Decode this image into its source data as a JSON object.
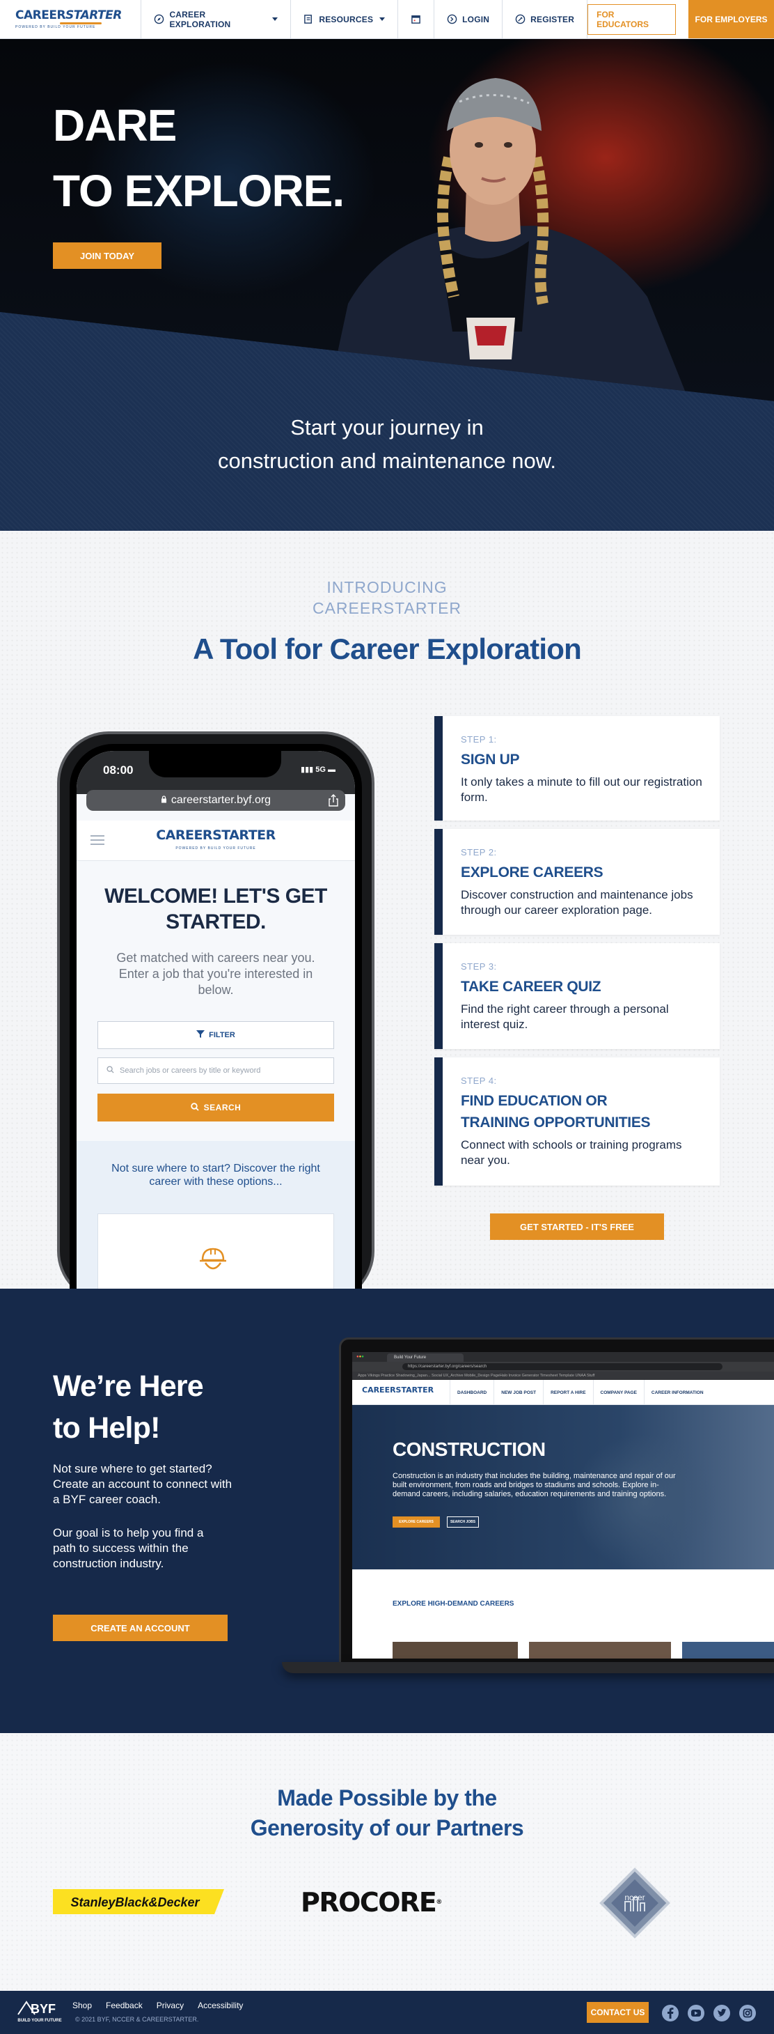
{
  "header": {
    "logo_text_a": "CAREER",
    "logo_text_b": "STARTER",
    "logo_sub": "POWERED BY BUILD YOUR FUTURE",
    "nav": {
      "career_exploration": "CAREER EXPLORATION",
      "resources": "RESOURCES",
      "login": "LOGIN",
      "register": "REGISTER",
      "for_educators": "FOR EDUCATORS",
      "for_employers": "FOR EMPLOYERS"
    }
  },
  "hero": {
    "title_line1": "DARE",
    "title_line2": "TO EXPLORE.",
    "cta": "JOIN TODAY",
    "tagline_line1": "Start your journey in",
    "tagline_line2": "construction and maintenance now."
  },
  "intro": {
    "eyebrow_line1": "INTRODUCING",
    "eyebrow_line2": "CAREERSTARTER",
    "title": "A Tool for Career Exploration",
    "phone": {
      "time": "08:00",
      "signal": "5G",
      "url": "careerstarter.byf.org",
      "welcome_line1": "WELCOME! LET'S GET",
      "welcome_line2": "STARTED.",
      "subtitle": "Get matched with careers near you. Enter a job that you're interested in below.",
      "filter_label": "FILTER",
      "search_placeholder": "Search jobs or careers by title or keyword",
      "search_label": "SEARCH",
      "not_sure": "Not sure where to start? Discover the right career with these options..."
    },
    "steps": [
      {
        "label": "STEP 1:",
        "title": "SIGN UP",
        "desc": "It only takes a minute to fill out our registration form."
      },
      {
        "label": "STEP 2:",
        "title": "EXPLORE CAREERS",
        "desc": "Discover construction and maintenance jobs through our career exploration page."
      },
      {
        "label": "STEP 3:",
        "title": "TAKE CAREER QUIZ",
        "desc": "Find the right career through a personal interest quiz."
      },
      {
        "label": "STEP 4:",
        "title_line1": "FIND EDUCATION OR",
        "title_line2": "TRAINING OPPORTUNITIES",
        "desc": "Connect with schools or training programs near you."
      }
    ],
    "cta": "GET STARTED - IT'S FREE"
  },
  "help": {
    "title_line1": "We’re Here",
    "title_line2": "to Help!",
    "p1": "Not sure where to get started? Create an account to connect with a BYF career coach.",
    "p2": "Our goal is to help you find a path to success within the construction industry.",
    "cta": "CREATE AN ACCOUNT",
    "laptop": {
      "tab_title": "Build Your Future",
      "url": "https://careerstarter.byf.org/careers/search",
      "bookmarks": "Apps   Vikings Practice   Shadowing_Japan...   Social   UX_Archive   Mobile_Design   PageHalo   Invoice Generator   Timesheet Template   UNAA Stuff",
      "logo": "CAREERSTARTER",
      "nav": [
        "DASHBOARD",
        "NEW JOB POST",
        "REPORT A HIRE",
        "COMPANY PAGE",
        "CAREER INFORMATION"
      ],
      "hero_title": "CONSTRUCTION",
      "hero_text": "Construction is an industry that includes the building, maintenance and repair of our built environment, from roads and bridges to stadiums and schools. Explore in-demand careers, including salaries, education requirements and training options.",
      "btn1": "EXPLORE CAREERS",
      "btn2": "SEARCH JOBS",
      "section": "EXPLORE HIGH-DEMAND CAREERS"
    }
  },
  "partners": {
    "title_line1": "Made Possible by the",
    "title_line2": "Generosity of our Partners",
    "sbd": "StanleyBlack&Decker",
    "procore": "PROCORE",
    "procore_mark": "®",
    "nccer": "nccer"
  },
  "footer": {
    "logo": "BYF",
    "logo_sub": "BUILD YOUR FUTURE",
    "links": [
      "Shop",
      "Feedback",
      "Privacy",
      "Accessibility"
    ],
    "copyright": "© 2021 BYF, NCCER & CAREERSTARTER.",
    "contact": "CONTACT US",
    "social": [
      "facebook-icon",
      "youtube-icon",
      "twitter-icon",
      "instagram-icon"
    ]
  },
  "colors": {
    "accent": "#e39024",
    "navy": "#16294a",
    "brand_blue": "#1f4e8c"
  }
}
